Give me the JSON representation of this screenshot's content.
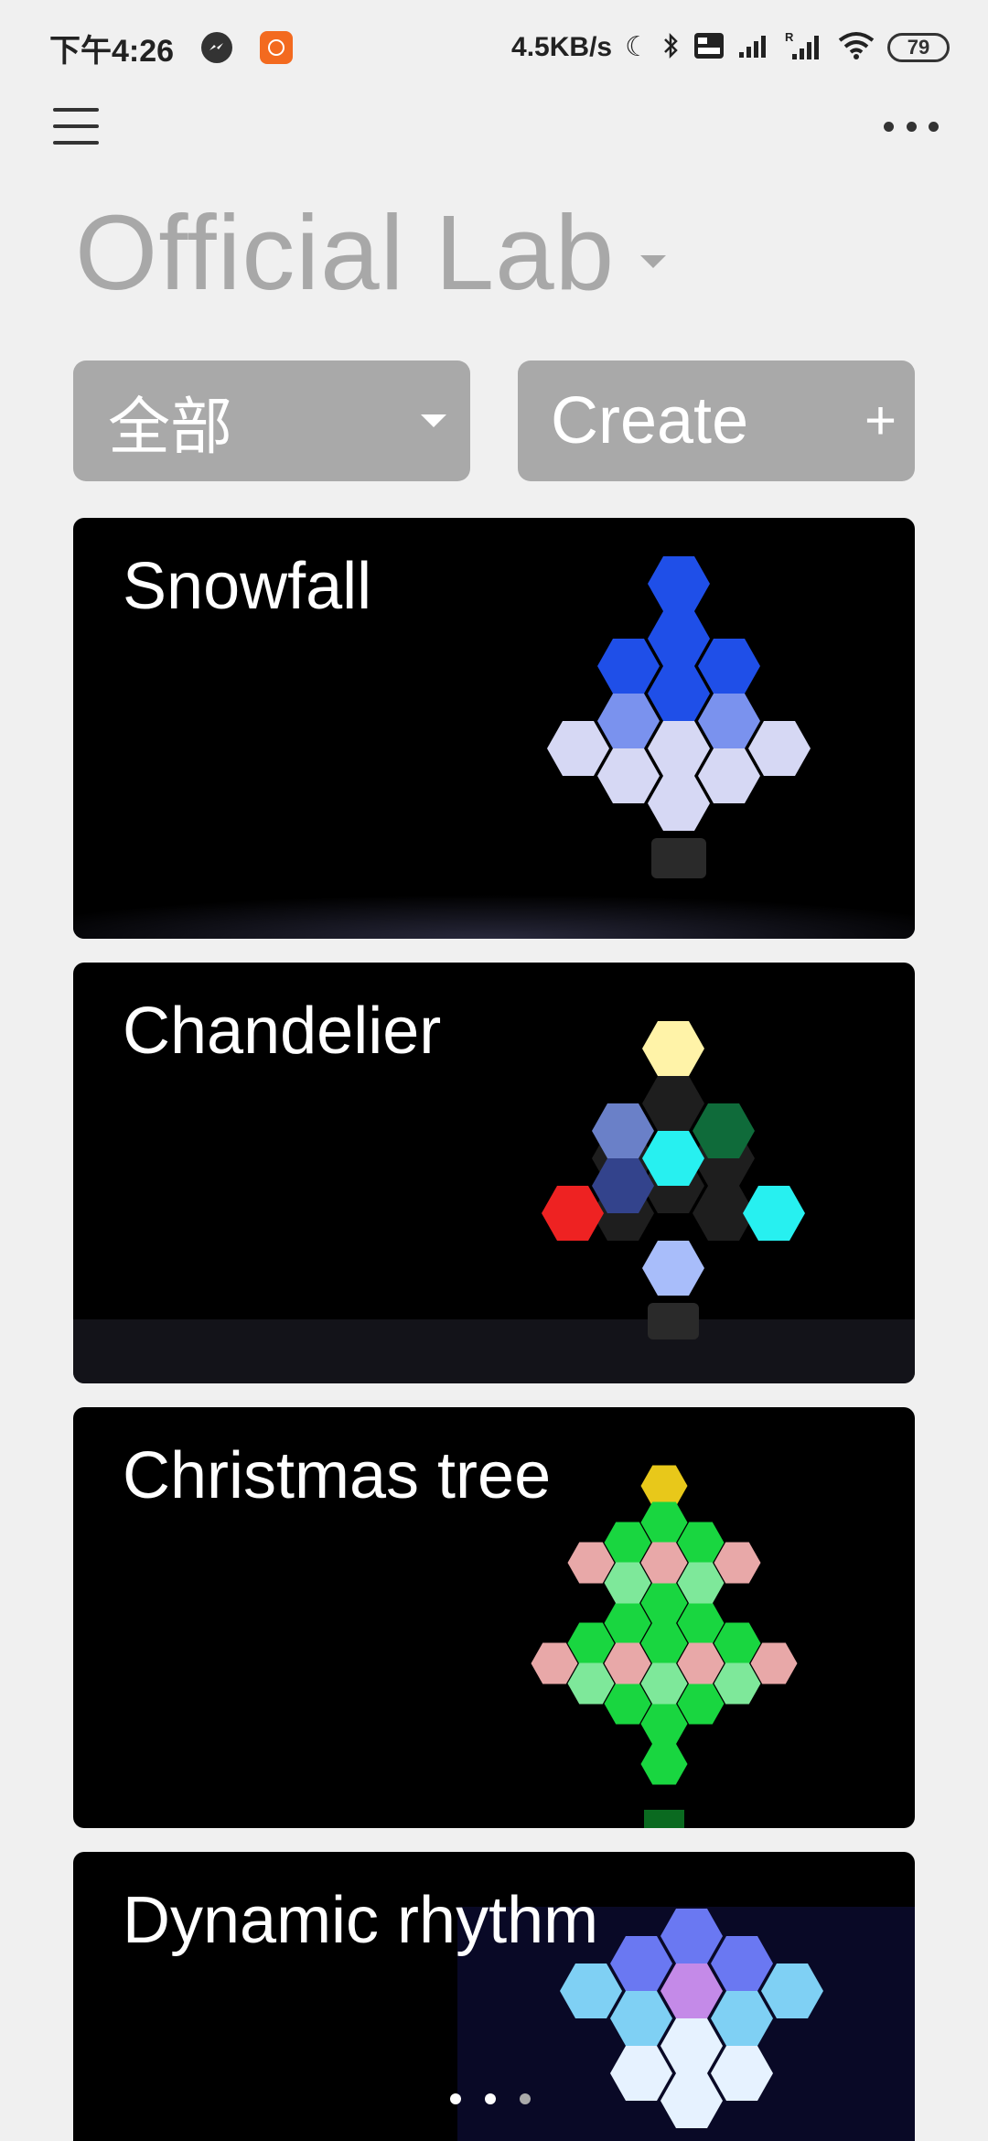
{
  "status_bar": {
    "time": "下午4:26",
    "net_speed": "4.5KB/s",
    "battery": "79"
  },
  "header": {
    "title": "Official Lab"
  },
  "filter": {
    "label": "全部"
  },
  "create": {
    "label": "Create",
    "plus": "+"
  },
  "cards": [
    {
      "title": "Snowfall"
    },
    {
      "title": "Chandelier"
    },
    {
      "title": "Christmas tree"
    },
    {
      "title": "Dynamic rhythm"
    }
  ],
  "pager": {
    "count": 3,
    "active": 1
  },
  "icons": {
    "menu": "menu-icon",
    "more": "more-icon",
    "dropdown": "chevron-down-icon",
    "add": "plus-icon"
  }
}
